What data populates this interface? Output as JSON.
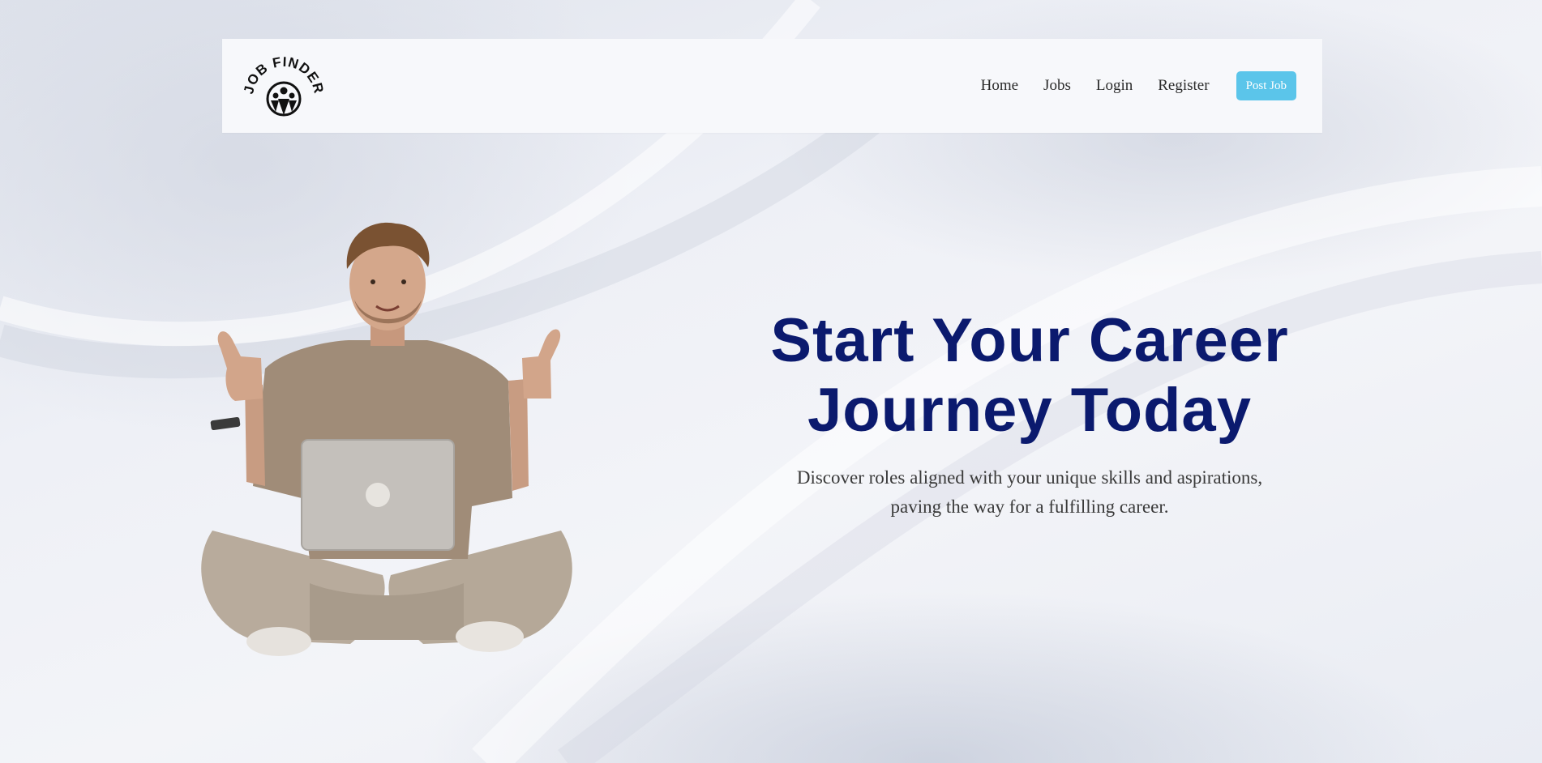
{
  "brand": {
    "logo_text": "JOB FINDER"
  },
  "nav": {
    "items": [
      {
        "label": "Home"
      },
      {
        "label": "Jobs"
      },
      {
        "label": "Login"
      },
      {
        "label": "Register"
      }
    ],
    "cta_label": "Post Job"
  },
  "hero": {
    "title_line1": "Start Your Career",
    "title_line2": "Journey Today",
    "subtitle": "Discover roles aligned with your unique skills and aspirations, paving the way for a fulfilling career.",
    "image_icon": "person-thumbs-up-laptop-illustration"
  },
  "colors": {
    "title": "#0b1a6e",
    "cta_bg": "#5bc5ea",
    "navbar_bg": "#f7f8fb",
    "body_text": "#3a3a3a"
  }
}
